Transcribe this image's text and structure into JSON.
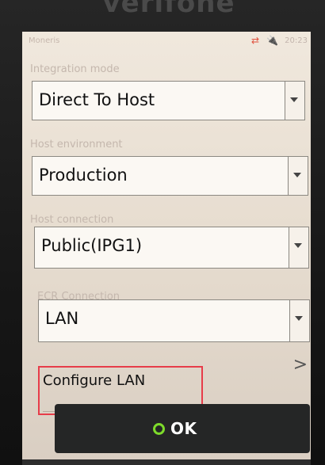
{
  "status_bar": {
    "app_name": "Moneris",
    "time": "20:23",
    "transfer_icon": "⇄",
    "plug_icon": "🔌"
  },
  "fields": [
    {
      "label": "Integration mode",
      "value": "Direct To Host"
    },
    {
      "label": "Host environment",
      "value": "Production"
    },
    {
      "label": "Host connection",
      "value": "Public(IPG1)"
    },
    {
      "label": "ECR Connection",
      "value": "LAN"
    }
  ],
  "configure_lan": {
    "label": "Configure LAN",
    "chevron": ">"
  },
  "ok_button": {
    "label": "OK"
  },
  "colors": {
    "screen_bg": "#efe7dc",
    "highlight": "#e73c49",
    "ok_bg": "#252626",
    "ok_icon": "#7edb2b"
  }
}
